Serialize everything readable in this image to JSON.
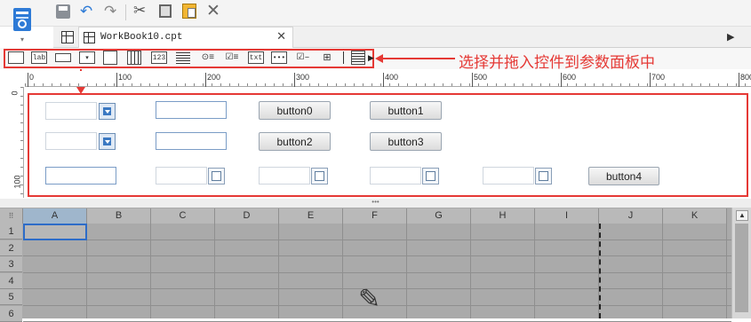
{
  "app": {
    "accent": "#3a7bd5"
  },
  "tab": {
    "title": "WorkBook10.cpt"
  },
  "toolbar_icons": [
    "save-icon",
    "undo-icon",
    "redo-icon",
    "cut-icon",
    "copy-icon",
    "paste-icon",
    "delete-icon"
  ],
  "widget_toolbar": {
    "items": [
      "textbox",
      "lab",
      "button",
      "dropdown",
      "tree",
      "calendar",
      "123",
      "textarea",
      "radio",
      "checkbox",
      "txt",
      "password",
      "checkbox2",
      "tree2",
      "frame"
    ],
    "labels": {
      "lab": "lab",
      "num": "123",
      "txt": "txt"
    }
  },
  "annotation": {
    "text": "选择并拖入控件到参数面板中",
    "color": "#e53935"
  },
  "ruler": {
    "ticks": [
      "0",
      "100",
      "200",
      "300",
      "400",
      "500",
      "600",
      "700",
      "800"
    ],
    "vticks": [
      "0",
      "100"
    ]
  },
  "params": {
    "buttons": [
      "button0",
      "button1",
      "button2",
      "button3",
      "button4"
    ]
  },
  "sheet": {
    "columns": [
      "A",
      "B",
      "C",
      "D",
      "E",
      "F",
      "G",
      "H",
      "I",
      "J",
      "K"
    ],
    "rows": [
      "1",
      "2",
      "3",
      "4",
      "5",
      "6"
    ],
    "selected_cell": "A1"
  }
}
